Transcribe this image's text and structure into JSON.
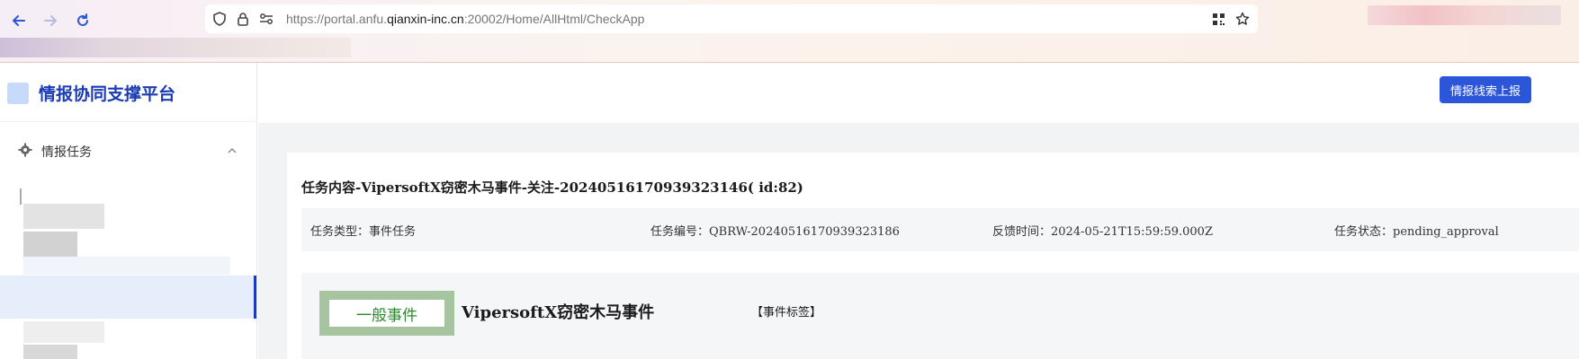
{
  "browser": {
    "url_prefix": "https://portal.anfu.",
    "url_domain": "qianxin-inc.cn",
    "url_suffix": ":20002/Home/AllHtml/CheckApp"
  },
  "sidebar": {
    "app_title": "情报协同支撑平台",
    "menu_group_label": "情报任务"
  },
  "header": {
    "report_button": "情报线索上报"
  },
  "task": {
    "title": "任务内容-VipersoftX窃密木马事件-关注-20240516170939323146( id:82)",
    "info": {
      "type": "任务类型：事件任务",
      "number": "任务编号：QBRW-20240516170939323186",
      "feedback_time": "反馈时间：2024-05-21T15:59:59.000Z",
      "status": "任务状态：pending_approval"
    },
    "event": {
      "level": "一般事件",
      "name": "VipersoftX窃密木马事件",
      "tags_label": "【事件标签】"
    }
  },
  "colors": {
    "brand": "#1a3bb3",
    "primary_button": "#2b56d9",
    "event_level_green": "#2a8a2a",
    "event_level_border": "#a6c4a0"
  }
}
